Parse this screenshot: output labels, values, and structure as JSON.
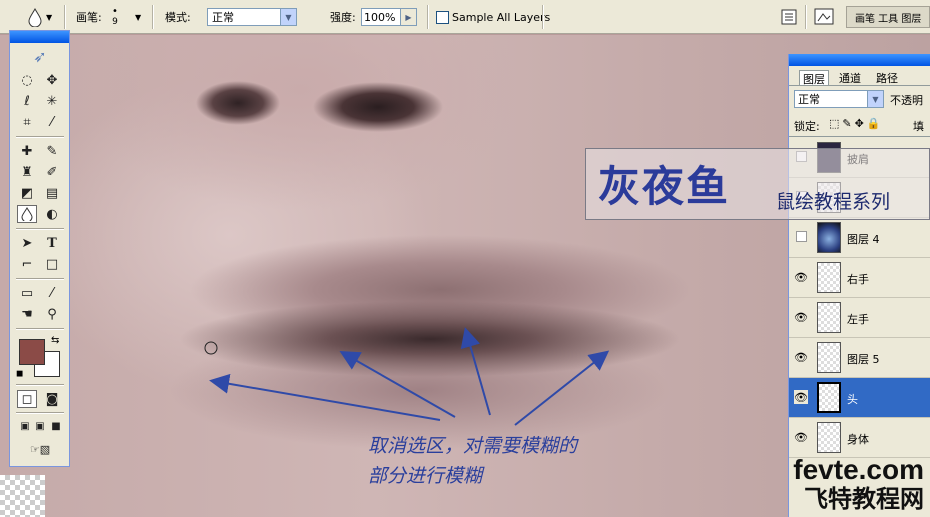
{
  "options_bar": {
    "brush_label": "画笔:",
    "brush_size": "9",
    "mode_label": "模式:",
    "mode_value": "正常",
    "strength_label": "强度:",
    "strength_value": "100%",
    "sample_all_layers_label": "Sample All Layers",
    "palette_well_tabs": "画笔 工具 图层"
  },
  "toolbox": {
    "tools": [
      "marquee",
      "move",
      "lasso",
      "magic-wand",
      "crop",
      "slice",
      "healing",
      "brush",
      "stamp",
      "history-brush",
      "eraser",
      "gradient",
      "blur",
      "dodge",
      "path-select",
      "type",
      "pen",
      "shape",
      "notes",
      "eyedropper",
      "hand",
      "zoom"
    ],
    "foreground_color": "#8b4b47",
    "background_color": "#ffffff"
  },
  "layers_panel": {
    "tabs": [
      "图层",
      "通道",
      "路径"
    ],
    "blend_mode": "正常",
    "opacity_label": "不透明",
    "lock_label": "锁定:",
    "fill_label": "填",
    "layers": [
      {
        "name": "披肩",
        "visible": false,
        "selected": false
      },
      {
        "name": "",
        "visible": false,
        "selected": false
      },
      {
        "name": "图层 4",
        "visible": false,
        "selected": false
      },
      {
        "name": "右手",
        "visible": true,
        "selected": false
      },
      {
        "name": "左手",
        "visible": true,
        "selected": false
      },
      {
        "name": "图层 5",
        "visible": true,
        "selected": false
      },
      {
        "name": "头",
        "visible": true,
        "selected": true
      },
      {
        "name": "身体",
        "visible": true,
        "selected": false
      }
    ]
  },
  "overlay": {
    "logo_title": "灰夜鱼",
    "logo_subtitle": "鼠绘教程系列",
    "annotation_line1": "取消选区，对需要模糊的",
    "annotation_line2": "部分进行模糊",
    "watermark_url": "fevte.com",
    "watermark_name": "飞特教程网"
  }
}
